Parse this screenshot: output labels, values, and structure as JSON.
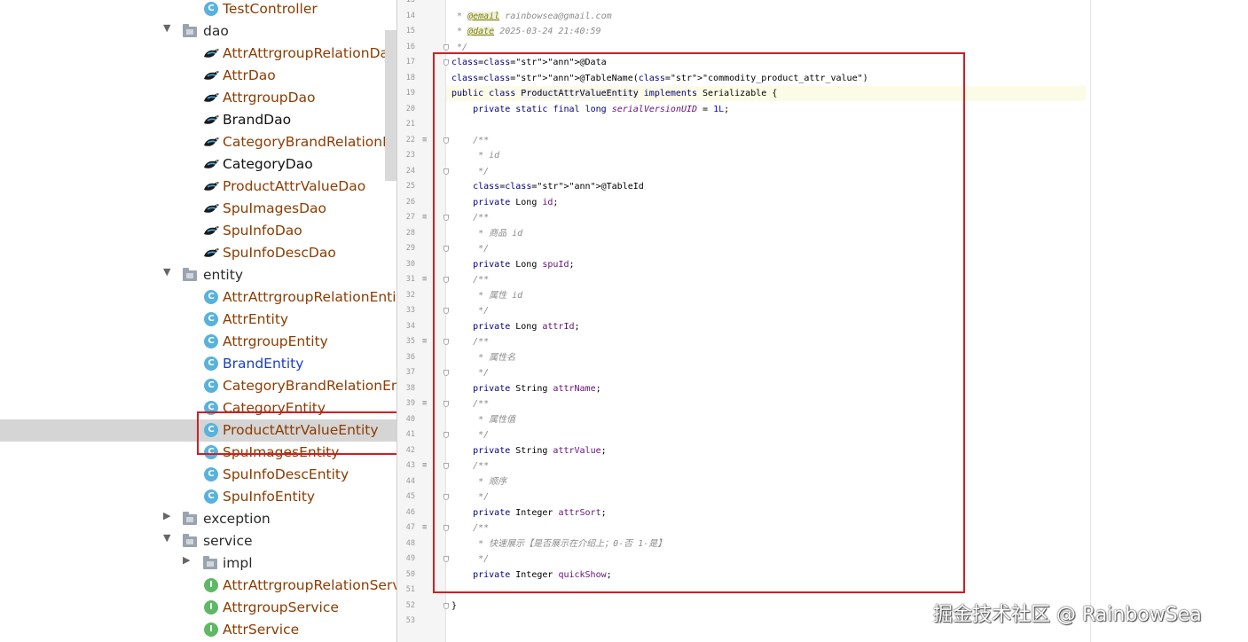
{
  "tree": {
    "items": [
      {
        "label": "TestController",
        "kind": "class",
        "color": "brown"
      },
      {
        "label": "dao",
        "kind": "package",
        "expanded": true
      },
      {
        "label": "AttrAttrgroupRelationDao",
        "kind": "dao",
        "color": "brown"
      },
      {
        "label": "AttrDao",
        "kind": "dao",
        "color": "brown"
      },
      {
        "label": "AttrgroupDao",
        "kind": "dao",
        "color": "brown"
      },
      {
        "label": "BrandDao",
        "kind": "dao",
        "color": "black"
      },
      {
        "label": "CategoryBrandRelationDao",
        "kind": "dao",
        "color": "brown"
      },
      {
        "label": "CategoryDao",
        "kind": "dao",
        "color": "black"
      },
      {
        "label": "ProductAttrValueDao",
        "kind": "dao",
        "color": "brown"
      },
      {
        "label": "SpuImagesDao",
        "kind": "dao",
        "color": "brown"
      },
      {
        "label": "SpuInfoDao",
        "kind": "dao",
        "color": "brown"
      },
      {
        "label": "SpuInfoDescDao",
        "kind": "dao",
        "color": "brown"
      },
      {
        "label": "entity",
        "kind": "package",
        "expanded": true
      },
      {
        "label": "AttrAttrgroupRelationEntity",
        "kind": "class",
        "color": "brown"
      },
      {
        "label": "AttrEntity",
        "kind": "class",
        "color": "brown"
      },
      {
        "label": "AttrgroupEntity",
        "kind": "class",
        "color": "brown"
      },
      {
        "label": "BrandEntity",
        "kind": "class",
        "color": "blue"
      },
      {
        "label": "CategoryBrandRelationEntity",
        "kind": "class",
        "color": "brown"
      },
      {
        "label": "CategoryEntity",
        "kind": "class",
        "color": "brown"
      },
      {
        "label": "ProductAttrValueEntity",
        "kind": "class",
        "color": "brown",
        "selected": true
      },
      {
        "label": "SpuImagesEntity",
        "kind": "class",
        "color": "brown"
      },
      {
        "label": "SpuInfoDescEntity",
        "kind": "class",
        "color": "brown"
      },
      {
        "label": "SpuInfoEntity",
        "kind": "class",
        "color": "brown"
      },
      {
        "label": "exception",
        "kind": "package",
        "expanded": false
      },
      {
        "label": "service",
        "kind": "package",
        "expanded": true
      },
      {
        "label": "impl",
        "kind": "subpackage",
        "expanded": false
      },
      {
        "label": "AttrAttrgroupRelationService",
        "kind": "interface",
        "color": "brown"
      },
      {
        "label": "AttrgroupService",
        "kind": "interface",
        "color": "brown"
      },
      {
        "label": "AttrService",
        "kind": "interface",
        "color": "brown"
      }
    ]
  },
  "editor": {
    "lines": [
      {
        "n": "13",
        "t": ""
      },
      {
        "n": "14",
        "t": " * @email rainbowsea@gmail.com"
      },
      {
        "n": "15",
        "t": " * @date 2025-03-24 21:40:59"
      },
      {
        "n": "16",
        "t": " */"
      },
      {
        "n": "17",
        "t": "@Data"
      },
      {
        "n": "18",
        "t": "@TableName(\"commodity_product_attr_value\")"
      },
      {
        "n": "19",
        "t": "public class ProductAttrValueEntity implements Serializable {"
      },
      {
        "n": "20",
        "t": "    private static final long serialVersionUID = 1L;"
      },
      {
        "n": "21",
        "t": ""
      },
      {
        "n": "22",
        "t": "    /**"
      },
      {
        "n": "23",
        "t": "     * id"
      },
      {
        "n": "24",
        "t": "     */"
      },
      {
        "n": "25",
        "t": "    @TableId"
      },
      {
        "n": "26",
        "t": "    private Long id;"
      },
      {
        "n": "27",
        "t": "    /**"
      },
      {
        "n": "28",
        "t": "     * 商品 id"
      },
      {
        "n": "29",
        "t": "     */"
      },
      {
        "n": "30",
        "t": "    private Long spuId;"
      },
      {
        "n": "31",
        "t": "    /**"
      },
      {
        "n": "32",
        "t": "     * 属性 id"
      },
      {
        "n": "33",
        "t": "     */"
      },
      {
        "n": "34",
        "t": "    private Long attrId;"
      },
      {
        "n": "35",
        "t": "    /**"
      },
      {
        "n": "36",
        "t": "     * 属性名"
      },
      {
        "n": "37",
        "t": "     */"
      },
      {
        "n": "38",
        "t": "    private String attrName;"
      },
      {
        "n": "39",
        "t": "    /**"
      },
      {
        "n": "40",
        "t": "     * 属性值"
      },
      {
        "n": "41",
        "t": "     */"
      },
      {
        "n": "42",
        "t": "    private String attrValue;"
      },
      {
        "n": "43",
        "t": "    /**"
      },
      {
        "n": "44",
        "t": "     * 顺序"
      },
      {
        "n": "45",
        "t": "     */"
      },
      {
        "n": "46",
        "t": "    private Integer attrSort;"
      },
      {
        "n": "47",
        "t": "    /**"
      },
      {
        "n": "48",
        "t": "     * 快速展示【是否展示在介绍上；0-否 1-是】"
      },
      {
        "n": "49",
        "t": "     */"
      },
      {
        "n": "50",
        "t": "    private Integer quickShow;"
      },
      {
        "n": "51",
        "t": ""
      },
      {
        "n": "52",
        "t": "}"
      },
      {
        "n": "53",
        "t": ""
      }
    ]
  },
  "watermark": "掘金技术社区 @ RainbowSea",
  "colors": {
    "highlight_box": "#d21e22",
    "selected_row": "#d5d5d5",
    "class_icon": "#58b2dc",
    "interface_icon": "#5fb865",
    "tree_text_brown": "#8b3c00",
    "tree_text_blue": "#1a3fbd"
  }
}
